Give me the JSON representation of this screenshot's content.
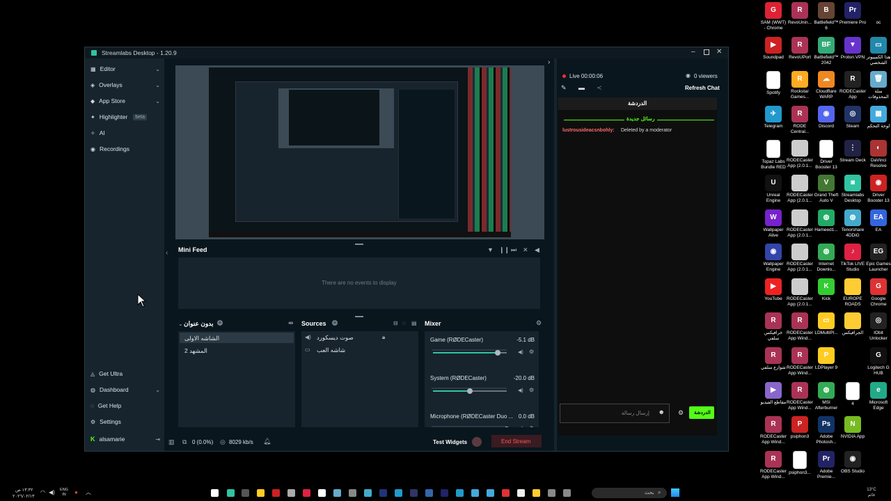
{
  "window": {
    "title": "Streamlabs Desktop - 1.20.9"
  },
  "sidebar": {
    "items": [
      {
        "label": "Editor",
        "icon": "editor-icon",
        "chev": true
      },
      {
        "label": "Overlays",
        "icon": "overlays-icon",
        "chev": true
      },
      {
        "label": "App Store",
        "icon": "app-store-icon",
        "chev": true
      },
      {
        "label": "Highlighter",
        "icon": "highlighter-icon",
        "chev": false,
        "badge": "beta"
      },
      {
        "label": "AI",
        "icon": "ai-icon",
        "chev": false
      },
      {
        "label": "Recordings",
        "icon": "recordings-icon",
        "chev": false
      }
    ],
    "bottom": [
      {
        "label": "Get Ultra",
        "icon": "ultra-icon",
        "chev": false
      },
      {
        "label": "Dashboard",
        "icon": "dashboard-icon",
        "chev": true
      },
      {
        "label": "Get Help",
        "icon": "help-icon",
        "chev": false
      },
      {
        "label": "Settings",
        "icon": "settings-icon",
        "chev": false
      }
    ],
    "user": "alsamarie"
  },
  "minifeed": {
    "title": "Mini Feed",
    "empty": "There are no events to display"
  },
  "scenes": {
    "title": "بدون عنوان",
    "items": [
      "الشاشه الاولى",
      "المشهد 2"
    ]
  },
  "sources": {
    "title": "Sources",
    "items": [
      "صوت ديسكورد",
      "شاشه العب"
    ]
  },
  "mixer": {
    "title": "Mixer",
    "channels": [
      {
        "name": "Game (RØDECaster)",
        "db": "-5.1 dB",
        "level": 0.88
      },
      {
        "name": "System (RØDECaster)",
        "db": "-20.0 dB",
        "level": 0.5
      },
      {
        "name": "Microphone (RØDECaster Duo ...",
        "db": "0.0 dB",
        "level": 1.0
      }
    ]
  },
  "statusbar": {
    "dropped": "0 (0.0%)",
    "bitrate": "8029 kb/s",
    "test_widgets": "Test Widgets",
    "end_stream": "End Stream"
  },
  "chat": {
    "live": "Live 00:00:06",
    "viewers": "0 viewers",
    "refresh": "Refresh Chat",
    "tab": "الدردشة",
    "new_messages": "رسائل جديدة",
    "message_user": "lustrousideacsnbohly:",
    "message_text": "Deleted by a moderator",
    "input_placeholder": "إرسال رسالة",
    "send": "الدردشة"
  },
  "desktop_icons": [
    [
      "SAM (WWT) - Chrome",
      "#d23",
      "G"
    ],
    [
      "RevoUnin...",
      "#a35",
      "R"
    ],
    [
      "Battlefield™ 6",
      "#643",
      "B"
    ],
    [
      "Premiere Pro",
      "#226",
      "Pr"
    ],
    [
      "oc",
      "#000",
      ""
    ],
    [
      "Soundpad",
      "#c22",
      "▶"
    ],
    [
      "RevoUPort",
      "#a35",
      "R"
    ],
    [
      "Battlefield™ 2042",
      "#3a7",
      "BF"
    ],
    [
      "Proton VPN",
      "#63c",
      "▼"
    ],
    [
      "هذا الكمبيوتر الشخصي",
      "#28a",
      "▭"
    ],
    [
      "Spotify",
      "#fff",
      ""
    ],
    [
      "Rockstar Games...",
      "#fa2",
      "R"
    ],
    [
      "Cloudflare WARP",
      "#e82",
      "☁"
    ],
    [
      "RODECaster App",
      "#222",
      "R"
    ],
    [
      "سلة المحذوفات",
      "#6ac",
      "🗑"
    ],
    [
      "Telegram",
      "#29c",
      "✈"
    ],
    [
      "RODE Central...",
      "#a35",
      "R"
    ],
    [
      "Discord",
      "#56e",
      "◉"
    ],
    [
      "Steam",
      "#236",
      "◎"
    ],
    [
      "لوحة التحكم",
      "#4ad",
      "▦"
    ],
    [
      "Topaz Labs Bundle RED",
      "#fff",
      ""
    ],
    [
      "RODECaster App (2.0.1...",
      "#ccc",
      ""
    ],
    [
      "Driver Booster 13",
      "#fff",
      ""
    ],
    [
      "Stream Deck",
      "#224",
      "⋮"
    ],
    [
      "DaVinci Resolve",
      "#a33",
      "◐"
    ],
    [
      "Unreal Engine",
      "#111",
      "U"
    ],
    [
      "RODECaster App (2.0.1...",
      "#ccc",
      ""
    ],
    [
      "Grand Theft Auto V",
      "#473",
      "V"
    ],
    [
      "Streamlabs Desktop",
      "#31c3a2",
      "◙"
    ],
    [
      "Driver Booster 13",
      "#c22",
      "◉"
    ],
    [
      "Wallpaper Alive",
      "#72c",
      "W"
    ],
    [
      "RODECaster App (2.0.1...",
      "#ccc",
      ""
    ],
    [
      "Hameed1...",
      "#2a6",
      "◍"
    ],
    [
      "Tenorshare 4DDiG",
      "#4ac",
      "◍"
    ],
    [
      "EA",
      "#36d",
      "EA"
    ],
    [
      "Wallpaper Engine",
      "#34a",
      "◉"
    ],
    [
      "RODECaster App (2.0.1...",
      "#ccc",
      ""
    ],
    [
      "Internet Downlo...",
      "#3a5",
      "◍"
    ],
    [
      "TikTok LIVE Studio",
      "#d24",
      "♪"
    ],
    [
      "Epic Games Launcher",
      "#222",
      "EG"
    ],
    [
      "YouTube",
      "#e22",
      "▶"
    ],
    [
      "RODECaster App (2.0.1...",
      "#ccc",
      ""
    ],
    [
      "Kick",
      "#3c3",
      "K"
    ],
    [
      "EUROPE ROADS",
      "#fc3",
      ""
    ],
    [
      "Google Chrome",
      "#d33",
      "G"
    ],
    [
      "خرافيكس سلفي",
      "#a35",
      "R"
    ],
    [
      "RODECaster App Wind...",
      "#a35",
      "R"
    ],
    [
      "LDMultiPl...",
      "#fc2",
      "▭"
    ],
    [
      "الجرافيكس",
      "#fc3",
      ""
    ],
    [
      "IObit Unlocker",
      "#222",
      "◎"
    ],
    [
      "شوارع سلفي",
      "#a35",
      "R"
    ],
    [
      "RODECaster App Wind...",
      "#a35",
      "R"
    ],
    [
      "LDPlayer 9",
      "#fc2",
      "P"
    ],
    [
      "",
      "#000",
      ""
    ],
    [
      "Logitech G HUB",
      "#111",
      "G"
    ],
    [
      "مقاطع الفيديو",
      "#86c",
      "▶"
    ],
    [
      "RODECaster App Wind...",
      "#a35",
      "R"
    ],
    [
      "MSI Afterburner",
      "#3a5",
      "◍"
    ],
    [
      "4",
      "#fff",
      ""
    ],
    [
      "Microsoft Edge",
      "#2a8",
      "e"
    ],
    [
      "RODECaster App Wind...",
      "#a35",
      "R"
    ],
    [
      "psiphon3",
      "#c22",
      "P"
    ],
    [
      "Adobe Photosh...",
      "#136",
      "Ps"
    ],
    [
      "NVIDIA App",
      "#7b2",
      "N"
    ],
    [
      "",
      "#000",
      ""
    ],
    [
      "RODECaster App Wind...",
      "#a35",
      "R"
    ],
    [
      "psiphon3...",
      "#fff",
      ""
    ],
    [
      "Adobe Premie...",
      "#226",
      "Pr"
    ],
    [
      "OBS Studio",
      "#222",
      "◉"
    ],
    [
      "",
      "#000",
      ""
    ]
  ],
  "taskbar": {
    "search": "بحث",
    "time": "١٣:٣٢ ص",
    "date": "٢٠٢٦/٠٢/١٣",
    "lang": "ENG IN",
    "weather": "13°C غائم"
  }
}
